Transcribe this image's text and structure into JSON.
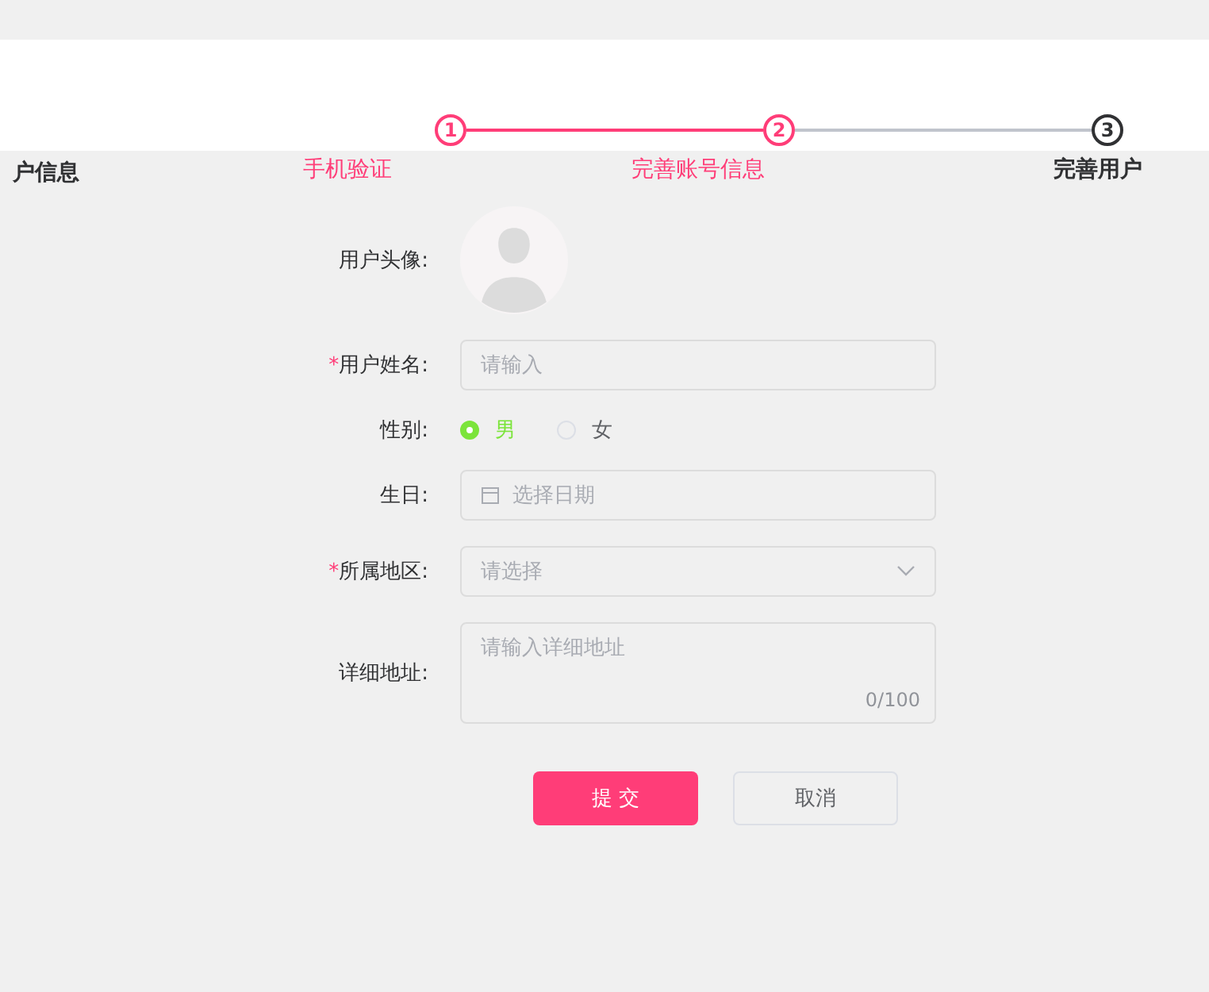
{
  "left_fragment": "户信息",
  "steps": [
    {
      "number": "1",
      "label": "手机验证",
      "finished": true
    },
    {
      "number": "2",
      "label": "完善账号信息",
      "finished": true
    },
    {
      "number": "3",
      "label": "完善用户",
      "finished": false
    }
  ],
  "form": {
    "rows": [
      {
        "kind": "avatar",
        "label": "用户头像:"
      },
      {
        "kind": "input",
        "mark": "*",
        "label": "用户姓名:",
        "placeholder": "请输入"
      },
      {
        "kind": "radio",
        "label": "性别:",
        "options": [
          {
            "label": "男",
            "selected": true
          },
          {
            "label": "女",
            "selected": false
          }
        ]
      },
      {
        "kind": "date",
        "label": "生日:",
        "placeholder": "选择日期"
      },
      {
        "kind": "select",
        "mark": "*",
        "label": "所属地区:",
        "placeholder": "请选择"
      },
      {
        "kind": "textarea",
        "label": "详细地址:",
        "placeholder": "请输入详细地址",
        "counter": "0/100"
      }
    ]
  },
  "buttons": [
    {
      "label": "提 交",
      "kind": "primary"
    },
    {
      "label": "取消",
      "kind": "default"
    }
  ]
}
